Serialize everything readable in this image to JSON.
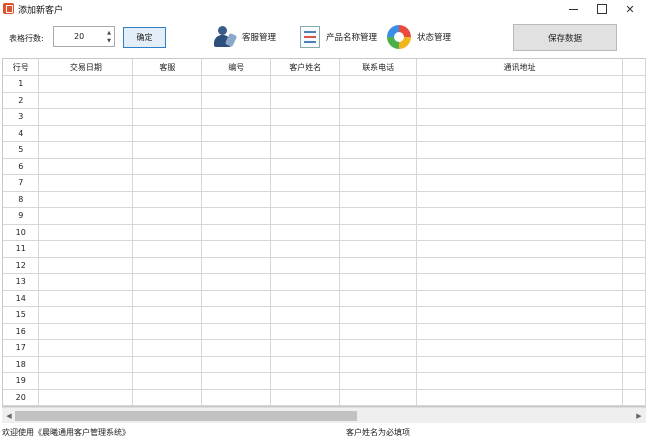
{
  "window": {
    "title": "添加新客户",
    "min_icon": "minimize-icon",
    "max_icon": "maximize-icon",
    "close_icon": "close-icon",
    "close_glyph": "✕"
  },
  "toolbar": {
    "rows_label": "表格行数:",
    "rows_value": "20",
    "confirm_label": "确定",
    "customer_service_label": "客服管理",
    "product_name_label": "产品名称管理",
    "status_label": "状态管理",
    "save_label": "保存数据"
  },
  "table": {
    "columns": [
      "行号",
      "交易日期",
      "客服",
      "编号",
      "客户姓名",
      "联系电话",
      "通讯地址"
    ],
    "rows": [
      "1",
      "2",
      "3",
      "4",
      "5",
      "6",
      "7",
      "8",
      "9",
      "10",
      "11",
      "12",
      "13",
      "14",
      "15",
      "16",
      "17",
      "18",
      "19",
      "20"
    ]
  },
  "status": {
    "left": "欢迎使用《晨曦通用客户管理系统》",
    "right": "客户姓名为必填项"
  },
  "colors": {
    "accent": "#2f7fc6",
    "app_icon": "#e0522e"
  }
}
